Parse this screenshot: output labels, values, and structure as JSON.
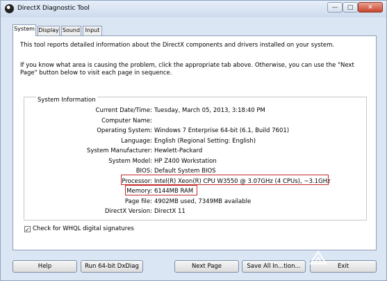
{
  "window": {
    "title": "DirectX Diagnostic Tool",
    "controls": {
      "minimize": "—",
      "maximize": "□",
      "close": "✕"
    }
  },
  "tabs": [
    {
      "label": "System",
      "active": true
    },
    {
      "label": "Display",
      "active": false
    },
    {
      "label": "Sound",
      "active": false
    },
    {
      "label": "Input",
      "active": false
    }
  ],
  "intro": {
    "line1": "This tool reports detailed information about the DirectX components and drivers installed on your system.",
    "line2": "If you know what area is causing the problem, click the appropriate tab above.  Otherwise, you can use the \"Next Page\" button below to visit each page in sequence."
  },
  "system_info": {
    "group_title": "System Information",
    "rows": [
      {
        "label": "Current Date/Time:",
        "value": "Tuesday, March 05, 2013, 3:18:40 PM"
      },
      {
        "label": "Computer Name:",
        "value": ""
      },
      {
        "label": "Operating System:",
        "value": "Windows 7 Enterprise 64-bit (6.1, Build 7601)"
      },
      {
        "label": "Language:",
        "value": "English (Regional Setting: English)"
      },
      {
        "label": "System Manufacturer:",
        "value": "Hewlett-Packard"
      },
      {
        "label": "System Model:",
        "value": "HP Z400 Workstation"
      },
      {
        "label": "BIOS:",
        "value": "Default System BIOS"
      },
      {
        "label": "Processor:",
        "value": "Intel(R) Xeon(R) CPU         W3550  @ 3.07GHz (4 CPUs), ~3.1GHz"
      },
      {
        "label": "Memory:",
        "value": "6144MB RAM"
      },
      {
        "label": "Page file:",
        "value": "4902MB used, 7349MB available"
      },
      {
        "label": "DirectX Version:",
        "value": "DirectX 11"
      }
    ]
  },
  "whql": {
    "label": "Check for WHQL digital signatures",
    "checked": true,
    "mark": "✓"
  },
  "buttons": {
    "help": "Help",
    "run64": "Run 64-bit DxDiag",
    "next": "Next Page",
    "save": "Save All In...tion...",
    "exit": "Exit"
  },
  "highlight_color": "#c22a2a"
}
